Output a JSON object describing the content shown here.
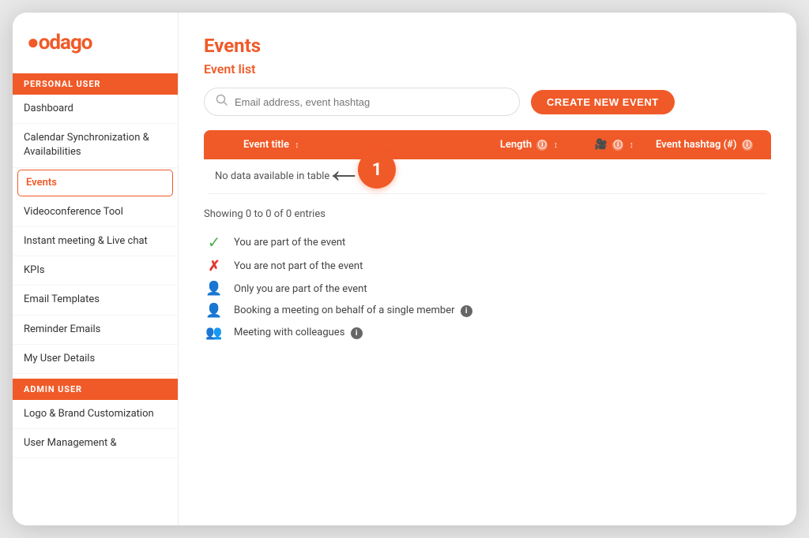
{
  "logo": {
    "text": "odago"
  },
  "sidebar": {
    "personal_user_label": "PERSONAL USER",
    "admin_user_label": "ADMIN USER",
    "items": [
      {
        "id": "dashboard",
        "label": "Dashboard",
        "active": false
      },
      {
        "id": "calendar",
        "label": "Calendar Synchronization & Availabilities",
        "active": false
      },
      {
        "id": "events",
        "label": "Events",
        "active": true
      },
      {
        "id": "videoconference",
        "label": "Videoconference Tool",
        "active": false
      },
      {
        "id": "instant-meeting",
        "label": "Instant meeting & Live chat",
        "active": false
      },
      {
        "id": "kpis",
        "label": "KPIs",
        "active": false
      },
      {
        "id": "email-templates",
        "label": "Email Templates",
        "active": false
      },
      {
        "id": "reminder-emails",
        "label": "Reminder Emails",
        "active": false
      },
      {
        "id": "my-user-details",
        "label": "My User Details",
        "active": false
      }
    ],
    "admin_items": [
      {
        "id": "logo-brand",
        "label": "Logo & Brand Customization",
        "active": false
      },
      {
        "id": "user-management",
        "label": "User Management &",
        "active": false
      }
    ]
  },
  "main": {
    "page_title": "Events",
    "section_title": "Event list",
    "search_placeholder": "Email address, event hashtag",
    "create_button_label": "CREATE NEW EVENT",
    "table": {
      "headers": [
        {
          "id": "checkbox",
          "label": "",
          "sortable": false
        },
        {
          "id": "event-title",
          "label": "Event title",
          "sortable": true
        },
        {
          "id": "length",
          "label": "Length",
          "info": true,
          "sortable": true
        },
        {
          "id": "video",
          "label": "",
          "info": true,
          "sortable": true,
          "video_icon": true
        },
        {
          "id": "hashtag",
          "label": "Event hashtag (#)",
          "info": true,
          "sortable": false
        }
      ],
      "no_data_text": "No data available in table"
    },
    "showing_text": "Showing 0 to 0 of 0 entries",
    "legend": [
      {
        "id": "part-of-event",
        "icon": "check",
        "text": "You are part of the event"
      },
      {
        "id": "not-part-of-event",
        "icon": "cross",
        "text": "You are not part of the event"
      },
      {
        "id": "only-you",
        "icon": "person-single",
        "text": "Only you are part of the event"
      },
      {
        "id": "booking-behalf",
        "icon": "person-info",
        "text": "Booking a meeting on behalf of a single member",
        "info": true
      },
      {
        "id": "meeting-colleagues",
        "icon": "persons-group",
        "text": "Meeting with colleagues",
        "info": true
      }
    ]
  },
  "annotation": {
    "badge_number": "1"
  }
}
